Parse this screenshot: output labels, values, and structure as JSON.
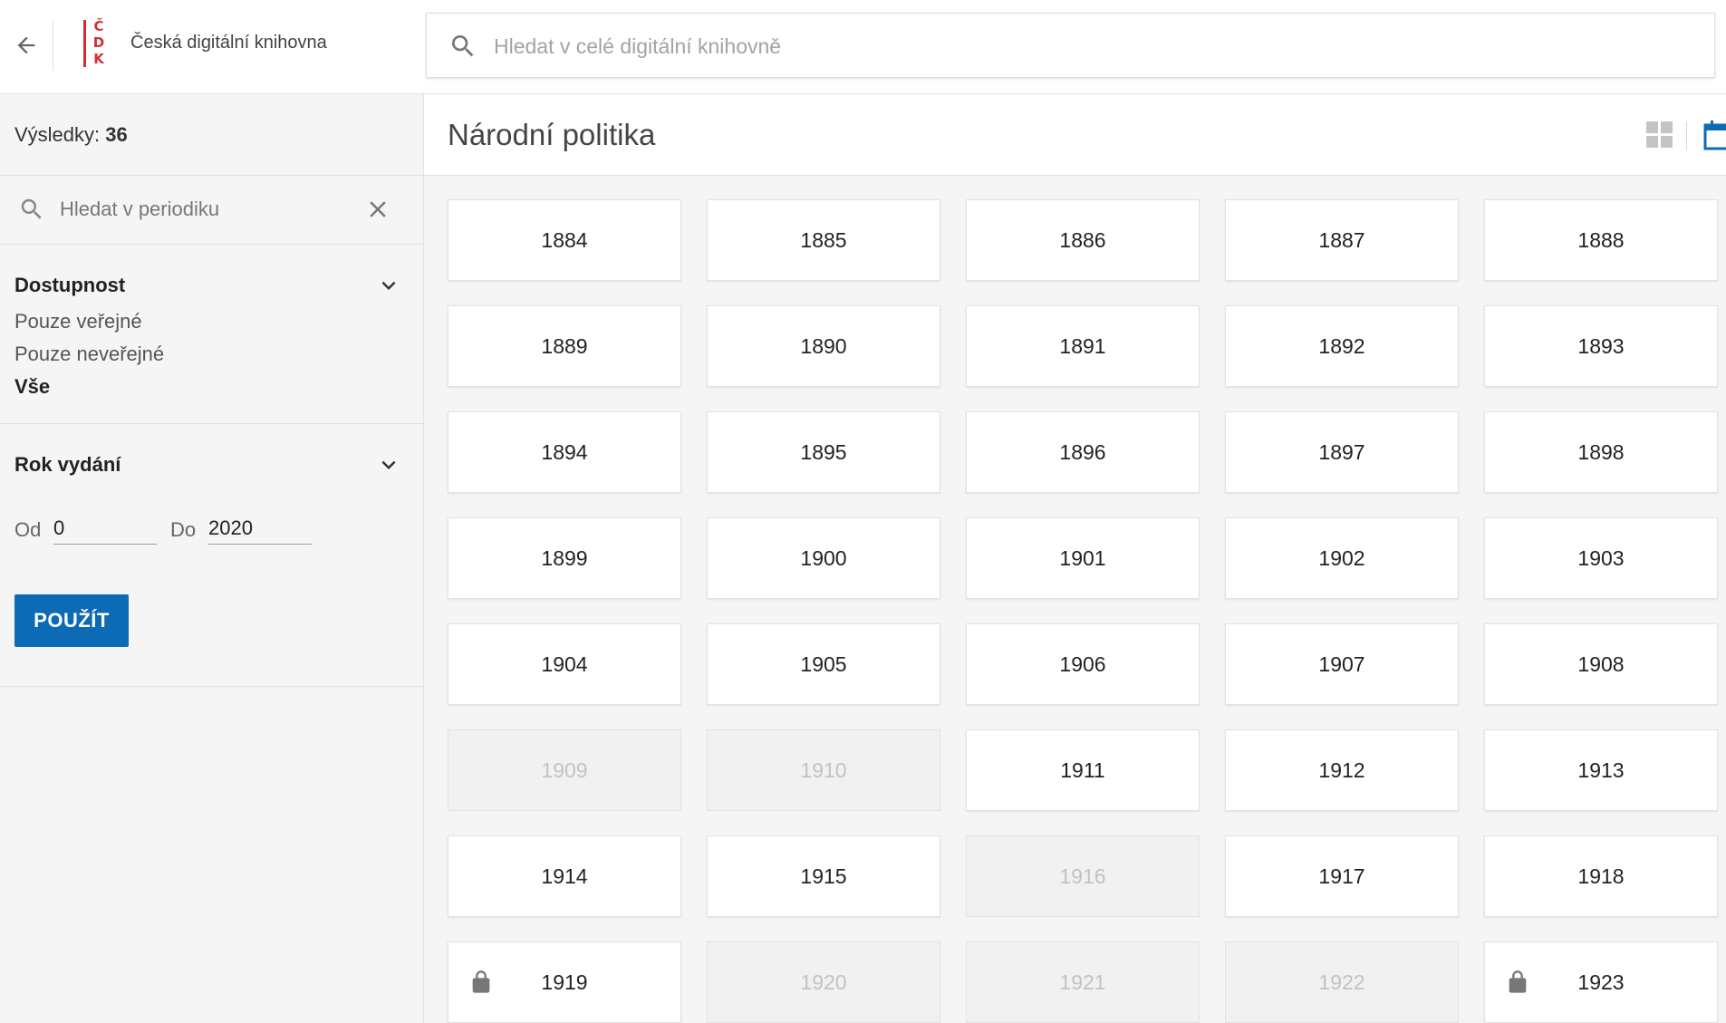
{
  "header": {
    "back_icon": "arrow-left-icon",
    "logo_letters": [
      "Č",
      "D",
      "K"
    ],
    "logo_color": "#d32f2f",
    "app_title": "Česká digitální knihovna",
    "search_placeholder": "Hledat v celé digitální knihovně"
  },
  "sidebar": {
    "results_label": "Výsledky:",
    "results_count": "36",
    "search_placeholder": "Hledat v periodiku",
    "availability": {
      "title": "Dostupnost",
      "options": [
        {
          "label": "Pouze veřejné",
          "active": false
        },
        {
          "label": "Pouze neveřejné",
          "active": false
        },
        {
          "label": "Vše",
          "active": true
        }
      ]
    },
    "year": {
      "title": "Rok vydání",
      "from_label": "Od",
      "from_value": "0",
      "to_label": "Do",
      "to_value": "2020",
      "apply_label": "POUŽÍT"
    }
  },
  "main": {
    "title": "Národní politika",
    "view_grid_icon": "grid-view-icon",
    "view_calendar_icon": "calendar-view-icon",
    "accent_color": "#0d6ab5",
    "years": [
      {
        "label": "1884",
        "available": true,
        "locked": false
      },
      {
        "label": "1885",
        "available": true,
        "locked": false
      },
      {
        "label": "1886",
        "available": true,
        "locked": false
      },
      {
        "label": "1887",
        "available": true,
        "locked": false
      },
      {
        "label": "1888",
        "available": true,
        "locked": false
      },
      {
        "label": "1889",
        "available": true,
        "locked": false
      },
      {
        "label": "1890",
        "available": true,
        "locked": false
      },
      {
        "label": "1891",
        "available": true,
        "locked": false
      },
      {
        "label": "1892",
        "available": true,
        "locked": false
      },
      {
        "label": "1893",
        "available": true,
        "locked": false
      },
      {
        "label": "1894",
        "available": true,
        "locked": false
      },
      {
        "label": "1895",
        "available": true,
        "locked": false
      },
      {
        "label": "1896",
        "available": true,
        "locked": false
      },
      {
        "label": "1897",
        "available": true,
        "locked": false
      },
      {
        "label": "1898",
        "available": true,
        "locked": false
      },
      {
        "label": "1899",
        "available": true,
        "locked": false
      },
      {
        "label": "1900",
        "available": true,
        "locked": false
      },
      {
        "label": "1901",
        "available": true,
        "locked": false
      },
      {
        "label": "1902",
        "available": true,
        "locked": false
      },
      {
        "label": "1903",
        "available": true,
        "locked": false
      },
      {
        "label": "1904",
        "available": true,
        "locked": false
      },
      {
        "label": "1905",
        "available": true,
        "locked": false
      },
      {
        "label": "1906",
        "available": true,
        "locked": false
      },
      {
        "label": "1907",
        "available": true,
        "locked": false
      },
      {
        "label": "1908",
        "available": true,
        "locked": false
      },
      {
        "label": "1909",
        "available": false,
        "locked": false
      },
      {
        "label": "1910",
        "available": false,
        "locked": false
      },
      {
        "label": "1911",
        "available": true,
        "locked": false
      },
      {
        "label": "1912",
        "available": true,
        "locked": false
      },
      {
        "label": "1913",
        "available": true,
        "locked": false
      },
      {
        "label": "1914",
        "available": true,
        "locked": false
      },
      {
        "label": "1915",
        "available": true,
        "locked": false
      },
      {
        "label": "1916",
        "available": false,
        "locked": false
      },
      {
        "label": "1917",
        "available": true,
        "locked": false
      },
      {
        "label": "1918",
        "available": true,
        "locked": false
      },
      {
        "label": "1919",
        "available": true,
        "locked": true
      },
      {
        "label": "1920",
        "available": false,
        "locked": false
      },
      {
        "label": "1921",
        "available": false,
        "locked": false
      },
      {
        "label": "1922",
        "available": false,
        "locked": false
      },
      {
        "label": "1923",
        "available": true,
        "locked": true
      }
    ]
  }
}
